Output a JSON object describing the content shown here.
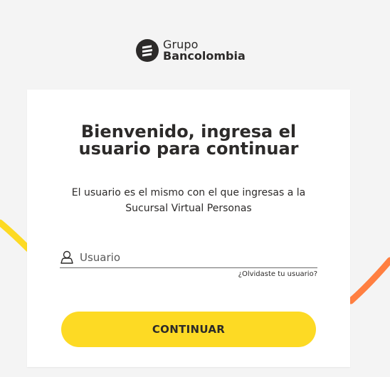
{
  "brand": {
    "top_text": "Grupo",
    "bottom_text": "Bancolombia",
    "logo_icon": "bancolombia-logo-icon"
  },
  "colors": {
    "background": "#f4f4f4",
    "card": "#ffffff",
    "text": "#2c2a29",
    "primary_button": "#fdda24",
    "yellow_arc": "#fdda24",
    "orange_arc": "#ff7f41"
  },
  "login": {
    "title": "Bienvenido, ingresa el usuario para continuar",
    "subtitle": "El usuario es el mismo con el que ingresas a la Sucursal Virtual Personas",
    "username_placeholder": "Usuario",
    "username_value": "",
    "username_icon": "user-icon",
    "forgot_link": "¿Olvidaste tu usuario?",
    "continue_label": "CONTINUAR"
  }
}
